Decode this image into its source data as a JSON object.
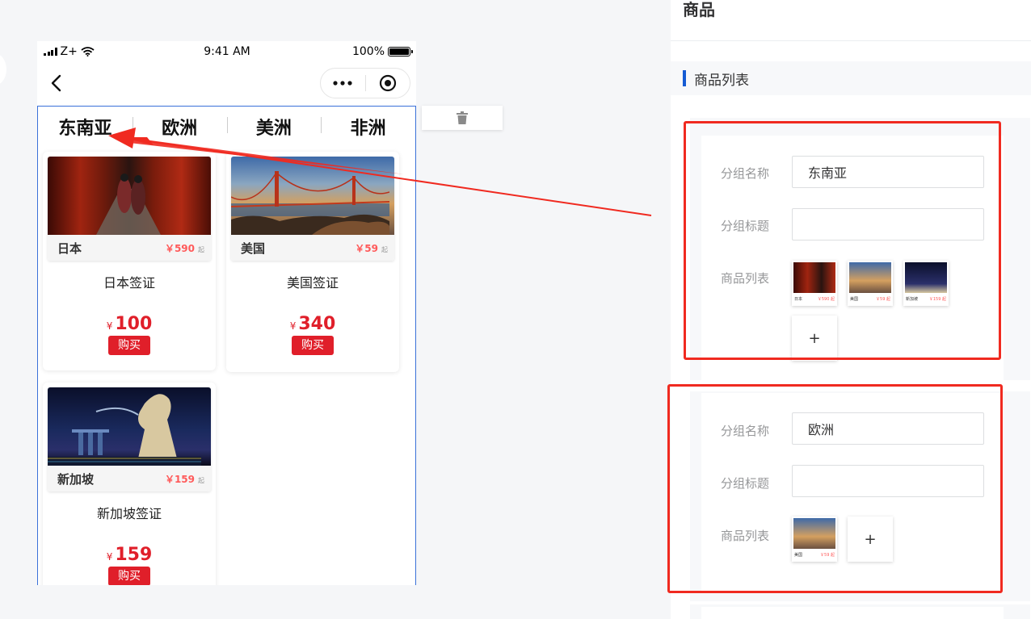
{
  "phone": {
    "status": {
      "carrier": "Z+",
      "time": "9:41 AM",
      "battery": "100%"
    },
    "tabs": [
      "东南亚",
      "欧洲",
      "美洲",
      "非洲"
    ],
    "products": [
      {
        "thumb_name": "日本",
        "thumb_price": "￥590",
        "thumb_suffix": "起",
        "title": "日本签证",
        "currency": "¥",
        "price": "100",
        "buy_label": "购买"
      },
      {
        "thumb_name": "美国",
        "thumb_price": "￥59",
        "thumb_suffix": "起",
        "title": "美国签证",
        "currency": "¥",
        "price": "340",
        "buy_label": "购买"
      },
      {
        "thumb_name": "新加坡",
        "thumb_price": "￥159",
        "thumb_suffix": "起",
        "title": "新加坡签证",
        "currency": "¥",
        "price": "159",
        "buy_label": "购买"
      }
    ]
  },
  "panel": {
    "title": "商品",
    "section_label": "商品列表",
    "groups": [
      {
        "name_label": "分组名称",
        "name_value": "东南亚",
        "title_label": "分组标题",
        "title_value": "",
        "list_label": "商品列表",
        "items": [
          {
            "name": "日本",
            "price": "￥590 起"
          },
          {
            "name": "美国",
            "price": "￥59 起"
          },
          {
            "name": "新加坡",
            "price": "￥159 起"
          }
        ],
        "add_label": "+"
      },
      {
        "name_label": "分组名称",
        "name_value": "欧洲",
        "title_label": "分组标题",
        "title_value": "",
        "list_label": "商品列表",
        "items": [
          {
            "name": "美国",
            "price": "￥59 起"
          }
        ],
        "add_label": "+"
      }
    ]
  },
  "colors": {
    "accent_red": "#e01f2a",
    "annotation_red": "#f02a20",
    "selection_blue": "#3a71d9",
    "section_bar": "#155bd4"
  },
  "icons": [
    "back-arrow-icon",
    "more-dots-icon",
    "target-icon",
    "trash-icon",
    "signal-icon",
    "wifi-icon",
    "battery-icon"
  ]
}
